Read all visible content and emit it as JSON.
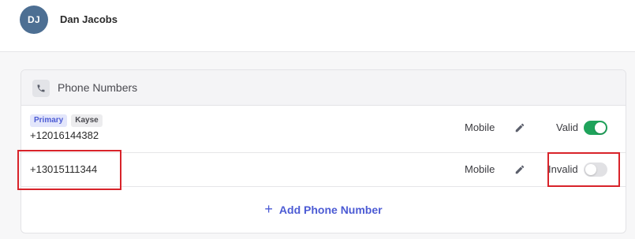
{
  "user": {
    "initials": "DJ",
    "name": "Dan Jacobs"
  },
  "phone_section": {
    "title": "Phone Numbers",
    "icon": "phone-icon",
    "numbers": [
      {
        "tags": [
          "Primary",
          "Kayse"
        ],
        "number": "+12016144382",
        "type": "Mobile",
        "status_label": "Valid",
        "valid": true
      },
      {
        "tags": [],
        "number": "+13015111344",
        "type": "Mobile",
        "status_label": "Invalid",
        "valid": false
      }
    ],
    "add_label": "Add Phone Number"
  },
  "colors": {
    "accent": "#4c5bd4",
    "toggle_on": "#1fa35b",
    "toggle_off": "#e1e1e4",
    "avatar": "#4d6f93",
    "highlight": "#d8232a"
  }
}
